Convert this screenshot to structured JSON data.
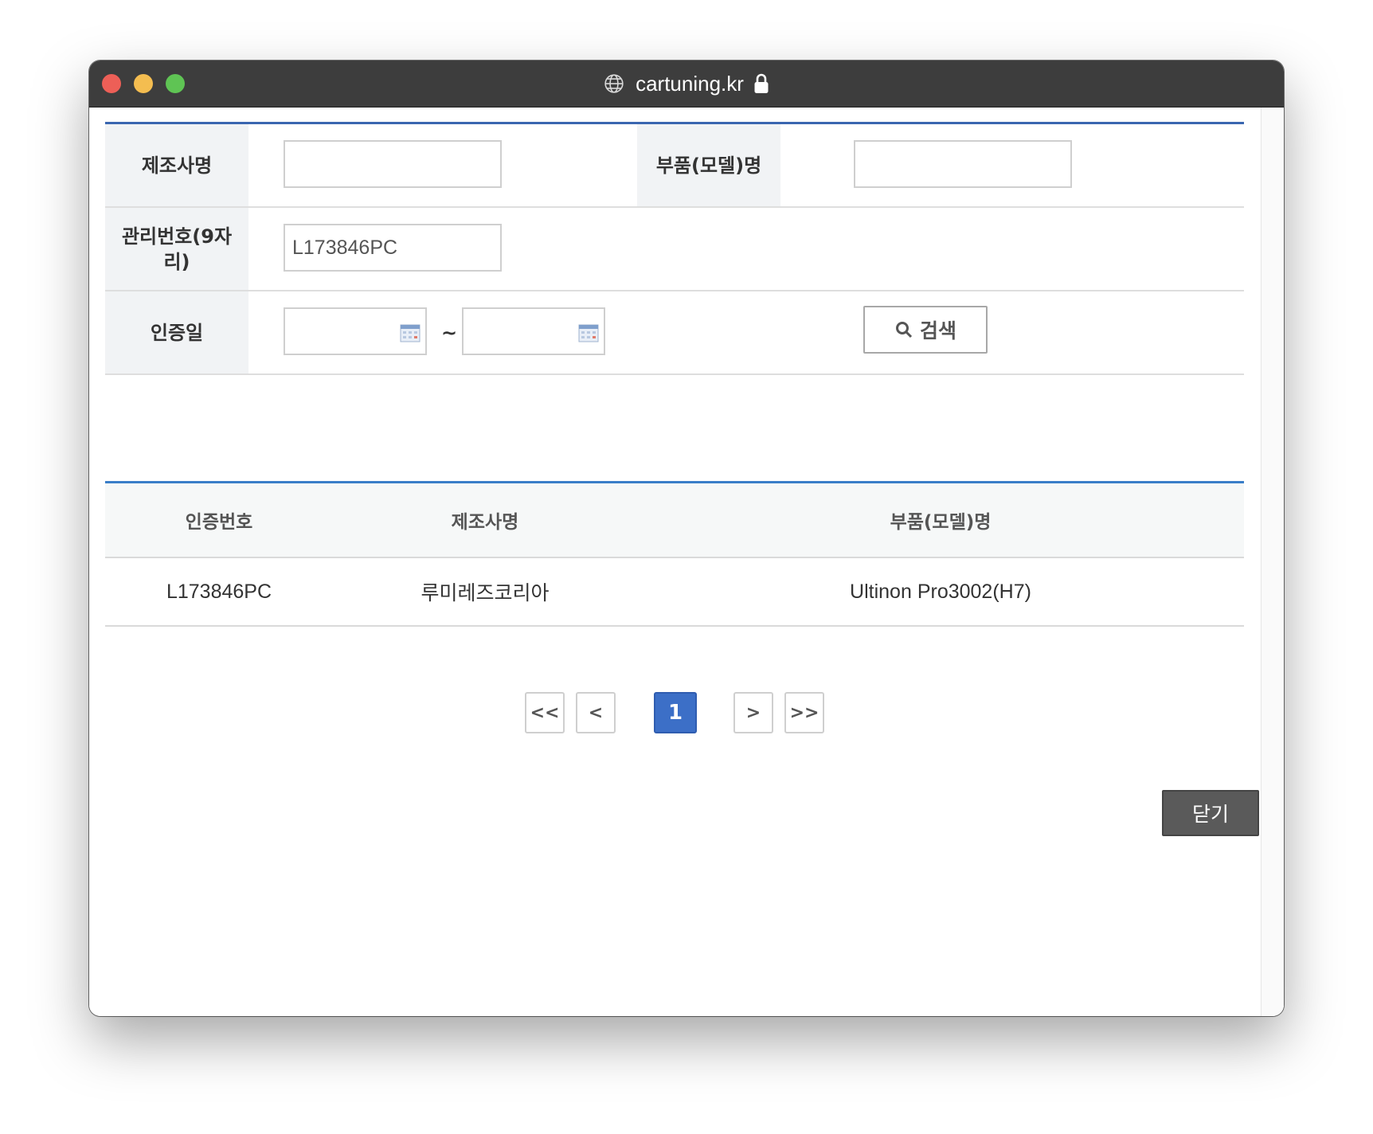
{
  "browser": {
    "url": "cartuning.kr"
  },
  "search_form": {
    "manufacturer_label": "제조사명",
    "manufacturer_value": "",
    "part_label": "부품(모델)명",
    "part_value": "",
    "mgmt_label": "관리번호(9자리)",
    "mgmt_value": "L173846PC",
    "date_label": "인증일",
    "date_from": "",
    "date_to": "",
    "date_separator": "~",
    "search_button": "검색"
  },
  "results": {
    "columns": [
      "인증번호",
      "제조사명",
      "부품(모델)명"
    ],
    "rows": [
      [
        "L173846PC",
        "루미레즈코리아",
        "Ultinon Pro3002(H7)"
      ]
    ]
  },
  "pagination": {
    "first": "<<",
    "prev": "<",
    "current": "1",
    "next": ">",
    "last": ">>"
  },
  "close_button": "닫기",
  "colors": {
    "accent": "#3a66b0",
    "active_page": "#3c6fc7",
    "close_button": "#5a5a5a"
  }
}
